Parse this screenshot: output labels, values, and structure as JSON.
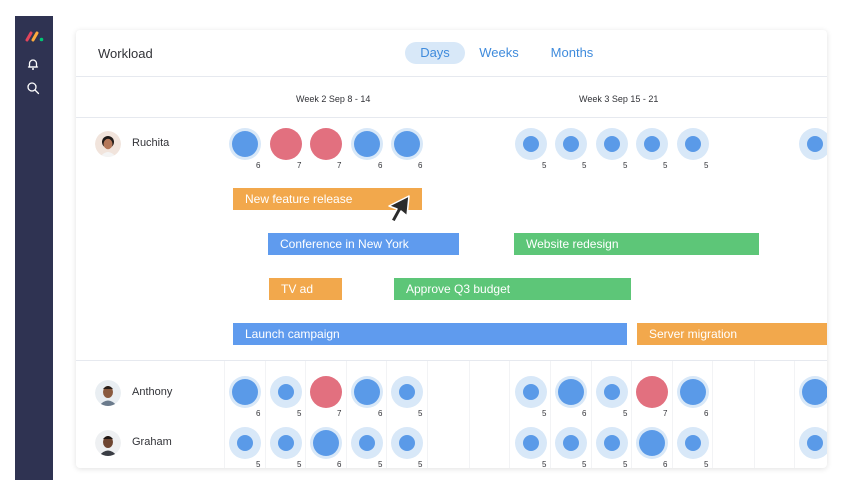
{
  "app": {
    "title": "Workload",
    "tabs": [
      {
        "label": "Days",
        "active": true
      },
      {
        "label": "Weeks",
        "active": false
      },
      {
        "label": "Months",
        "active": false
      }
    ]
  },
  "sidebar": {
    "icons": [
      "monday-logo-icon",
      "bell-icon",
      "search-icon"
    ]
  },
  "weeks": [
    {
      "label": "Week 2 Sep 8 - 14"
    },
    {
      "label": "Week 3 Sep 15 - 21"
    }
  ],
  "colors": {
    "accent": "#3f8bdc",
    "orange": "#f2a84c",
    "blue": "#5f9bee",
    "green": "#5dc678",
    "overload": "#e2707f",
    "light": "#d8e8f8",
    "dot": "#5a9ae8"
  },
  "people": [
    {
      "name": "Ruchita",
      "load": [
        {
          "n": "6",
          "state": "full"
        },
        {
          "n": "7",
          "state": "over"
        },
        {
          "n": "7",
          "state": "over"
        },
        {
          "n": "6",
          "state": "full"
        },
        {
          "n": "6",
          "state": "full"
        },
        {
          "n": "5",
          "state": "mid"
        },
        {
          "n": "5",
          "state": "mid"
        },
        {
          "n": "5",
          "state": "mid"
        },
        {
          "n": "5",
          "state": "mid"
        },
        {
          "n": "5",
          "state": "mid"
        },
        {
          "n": "",
          "state": "mid"
        }
      ]
    },
    {
      "name": "Anthony",
      "load": [
        {
          "n": "6",
          "state": "full"
        },
        {
          "n": "5",
          "state": "mid"
        },
        {
          "n": "7",
          "state": "over"
        },
        {
          "n": "6",
          "state": "full"
        },
        {
          "n": "5",
          "state": "mid"
        },
        {
          "n": "5",
          "state": "mid"
        },
        {
          "n": "6",
          "state": "full"
        },
        {
          "n": "5",
          "state": "mid"
        },
        {
          "n": "7",
          "state": "over"
        },
        {
          "n": "6",
          "state": "full"
        },
        {
          "n": "",
          "state": "full"
        }
      ]
    },
    {
      "name": "Graham",
      "load": [
        {
          "n": "5",
          "state": "mid"
        },
        {
          "n": "5",
          "state": "mid"
        },
        {
          "n": "6",
          "state": "full"
        },
        {
          "n": "5",
          "state": "mid"
        },
        {
          "n": "5",
          "state": "mid"
        },
        {
          "n": "5",
          "state": "mid"
        },
        {
          "n": "5",
          "state": "mid"
        },
        {
          "n": "5",
          "state": "mid"
        },
        {
          "n": "6",
          "state": "full"
        },
        {
          "n": "5",
          "state": "mid"
        },
        {
          "n": "",
          "state": "mid"
        }
      ]
    }
  ],
  "tasks": [
    {
      "label": "New feature release",
      "color": "orange"
    },
    {
      "label": "Conference in New York",
      "color": "blue"
    },
    {
      "label": "Website redesign",
      "color": "green"
    },
    {
      "label": "TV ad",
      "color": "orange"
    },
    {
      "label": "Approve Q3 budget",
      "color": "green"
    },
    {
      "label": "Launch campaign",
      "color": "blue"
    },
    {
      "label": "Server migration",
      "color": "orange"
    }
  ]
}
